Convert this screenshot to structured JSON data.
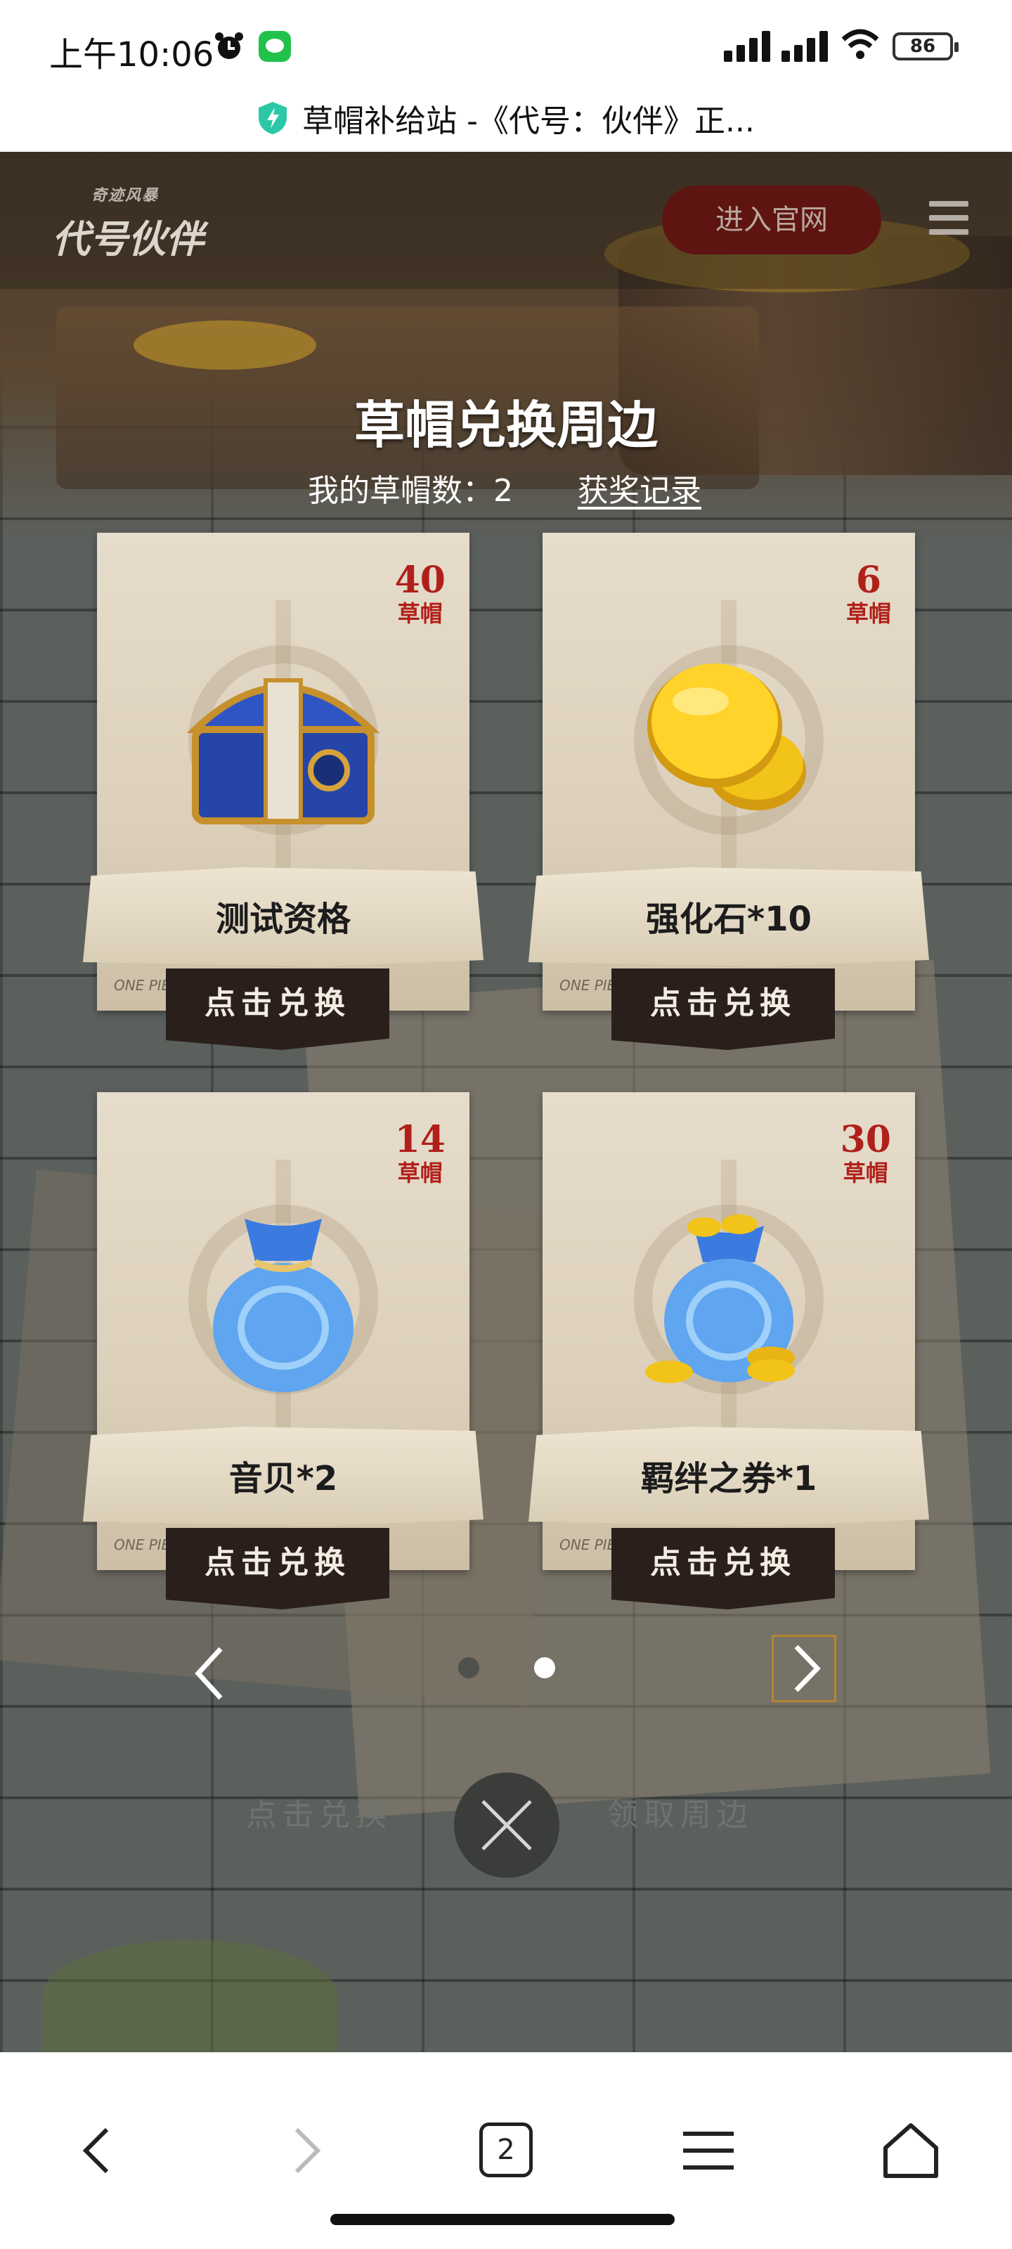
{
  "status_bar": {
    "time": "上午10:06",
    "battery": "86"
  },
  "address_bar": {
    "title": "草帽补给站 -《代号：伙伴》正..."
  },
  "header": {
    "logo_sub": "奇迹风暴",
    "logo_text": "代号伙伴",
    "enter_button": "进入官网"
  },
  "section": {
    "title": "草帽兑换周边",
    "hat_count_label": "我的草帽数：2",
    "record_link": "获奖记录"
  },
  "cards": [
    {
      "price": "40",
      "unit": "草帽",
      "name": "测试资格",
      "button": "点击兑换",
      "brand": "ONE PIECE",
      "icon": "treasure-chest-icon"
    },
    {
      "price": "6",
      "unit": "草帽",
      "name": "强化石*10",
      "button": "点击兑换",
      "brand": "ONE PIECE",
      "icon": "gold-coin-icon"
    },
    {
      "price": "14",
      "unit": "草帽",
      "name": "音贝*2",
      "button": "点击兑换",
      "brand": "ONE PIECE",
      "icon": "blue-bag-icon"
    },
    {
      "price": "30",
      "unit": "草帽",
      "name": "羁绊之券*1",
      "button": "点击兑换",
      "brand": "ONE PIECE",
      "icon": "coin-bag-icon"
    }
  ],
  "pager": {
    "active_page": 2,
    "page_count": 2
  },
  "footer_links": {
    "redeem": "点击兑换",
    "claim": "领取周边"
  },
  "browser_bar": {
    "tab_count": "2"
  }
}
